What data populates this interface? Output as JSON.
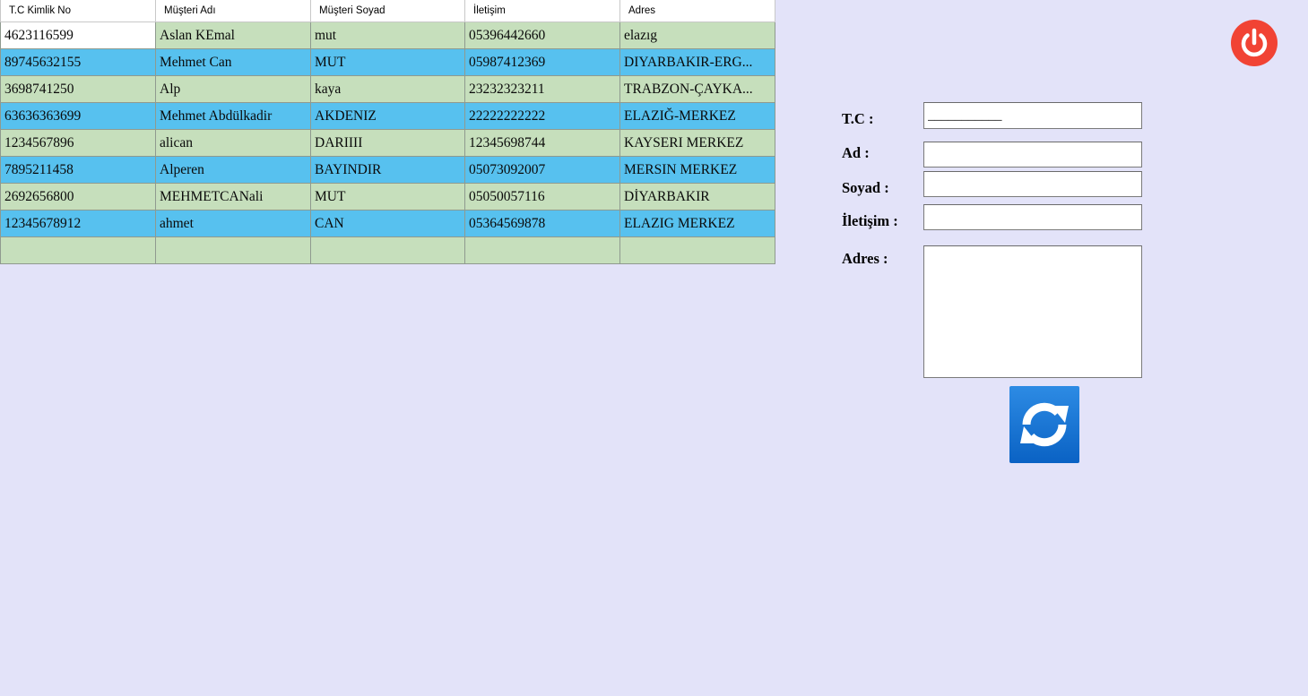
{
  "table": {
    "columns": [
      "T.C Kimlik No",
      "Müşteri Adı",
      "Müşteri Soyad",
      "İletişim",
      "Adres"
    ],
    "rows": [
      [
        "4623116599",
        "Aslan KEmal",
        "mut",
        "05396442660",
        "elazıg"
      ],
      [
        "89745632155",
        "Mehmet Can",
        "MUT",
        "05987412369",
        "DIYARBAKIR-ERG..."
      ],
      [
        "3698741250",
        "Alp",
        "kaya",
        "23232323211",
        "TRABZON-ÇAYKA..."
      ],
      [
        "63636363699",
        "Mehmet Abdülkadir",
        "AKDENIZ",
        "22222222222",
        "ELAZIĞ-MERKEZ"
      ],
      [
        "1234567896",
        "alican",
        "DARIIII",
        "12345698744",
        "KAYSERI MERKEZ"
      ],
      [
        "7895211458",
        "Alperen",
        "BAYINDIR",
        "05073092007",
        "MERSIN MERKEZ"
      ],
      [
        "2692656800",
        "MEHMETCANali",
        "MUT",
        "05050057116",
        "DİYARBAKIR"
      ],
      [
        "12345678912",
        "ahmet",
        "CAN",
        "05364569878",
        "ELAZIG MERKEZ"
      ],
      [
        "",
        "",
        "",
        "",
        ""
      ]
    ]
  },
  "form": {
    "tc_label": "T.C :",
    "tc_value": "___________",
    "ad_label": "Ad :",
    "ad_value": "",
    "soyad_label": "Soyad :",
    "soyad_value": "",
    "iletisim_label": "İletişim :",
    "iletisim_value": "",
    "adres_label": "Adres :",
    "adres_value": ""
  },
  "icons": {
    "power": "power-icon",
    "refresh": "refresh-icon"
  },
  "colors": {
    "background": "#e3e3f9",
    "row_green": "#c6dfbc",
    "row_blue": "#57c1ef",
    "power_red": "#f14334",
    "refresh_blue": "#1a74d4"
  }
}
